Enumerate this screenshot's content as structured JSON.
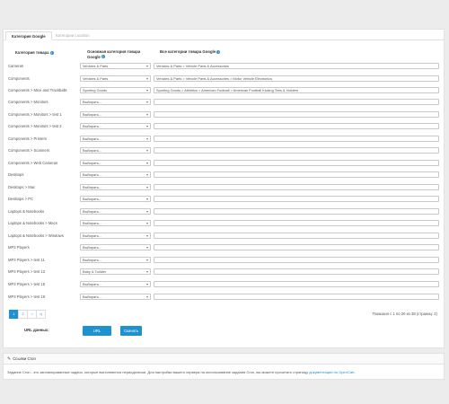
{
  "tabs": [
    {
      "label": "Категория Google"
    },
    {
      "label": "Категории Location"
    }
  ],
  "headers": {
    "store_category": "Категория товара",
    "main_google": "Основная категория товара Google",
    "all_google": "Все категории товара Google"
  },
  "rows": [
    {
      "label": "Cameras",
      "select": "Vehicles & Parts",
      "input": "Vehicles & Parts > Vehicle Parts & Accessories"
    },
    {
      "label": "Components",
      "select": "Vehicles & Parts",
      "input": "Vehicles & Parts > Vehicle Parts & Accessories > Motor Vehicle Electronics"
    },
    {
      "label": "Components > Mice and Trackballs",
      "select": "Sporting Goods",
      "input": "Sporting Goods > Athletics > American Football > American Football Kicking Tees & Holders"
    },
    {
      "label": "Components > Monitors",
      "select": "Выбирать...",
      "input": ""
    },
    {
      "label": "Components > Monitors > test 1",
      "select": "Выбирать...",
      "input": ""
    },
    {
      "label": "Components > Monitors > test 2",
      "select": "Выбирать...",
      "input": ""
    },
    {
      "label": "Components > Printers",
      "select": "Выбирать...",
      "input": ""
    },
    {
      "label": "Components > Scanners",
      "select": "Выбирать...",
      "input": ""
    },
    {
      "label": "Components > Web Cameras",
      "select": "Выбирать...",
      "input": ""
    },
    {
      "label": "Desktops",
      "select": "Выбирать...",
      "input": ""
    },
    {
      "label": "Desktops > Mac",
      "select": "Выбирать...",
      "input": ""
    },
    {
      "label": "Desktops > PC",
      "select": "Выбирать...",
      "input": ""
    },
    {
      "label": "Laptops & Notebooks",
      "select": "Выбирать...",
      "input": ""
    },
    {
      "label": "Laptops & Notebooks > Macs",
      "select": "Выбирать...",
      "input": ""
    },
    {
      "label": "Laptops & Notebooks > Windows",
      "select": "Выбирать...",
      "input": ""
    },
    {
      "label": "MP3 Players",
      "select": "Выбирать...",
      "input": ""
    },
    {
      "label": "MP3 Players > test 11",
      "select": "Выбирать...",
      "input": ""
    },
    {
      "label": "MP3 Players > test 12",
      "select": "Baby & Toddler",
      "input": ""
    },
    {
      "label": "MP3 Players > test 15",
      "select": "Выбирать...",
      "input": ""
    },
    {
      "label": "MP3 Players > test 16",
      "select": "Выбирать...",
      "input": ""
    }
  ],
  "pagination": {
    "pages": [
      "1",
      "2",
      ">",
      ">|"
    ],
    "status": "Показано с 1 по 20 из 38 (страниц: 2)"
  },
  "url_label": "URL данных:",
  "buttons": {
    "url": "URL",
    "download": "Скачать"
  },
  "cron": {
    "title": "Ссылки Cron",
    "text": "Задание Cron - это запланированные задачи, которые выполняются периодически. Для настройки вашего сервера на использование задания Cron, вы можете прочитать страницу",
    "link": "документации по OpenCart."
  },
  "colors": {
    "accent": "#1e91cf",
    "info": "#3a8dd3"
  }
}
